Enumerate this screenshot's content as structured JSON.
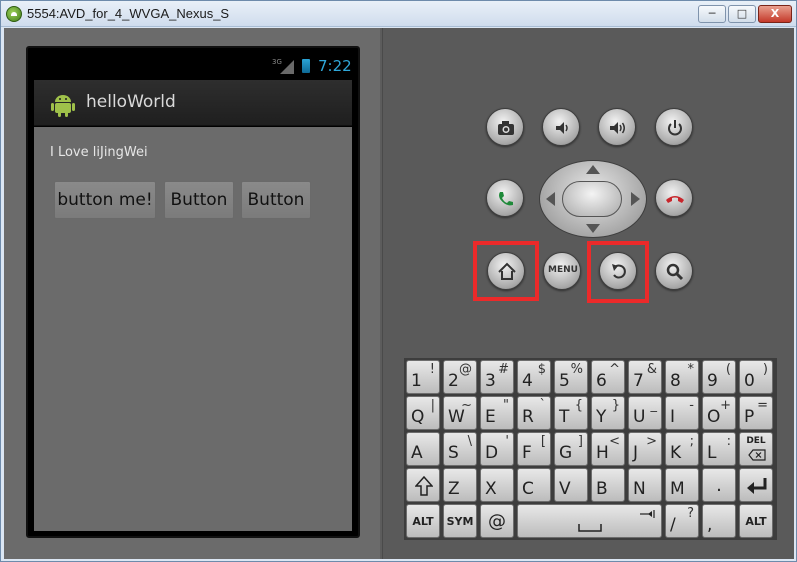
{
  "window": {
    "title": "5554:AVD_for_4_WVGA_Nexus_S",
    "minimize": "─",
    "maximize": "□",
    "close": "X"
  },
  "phone": {
    "network": "3G",
    "time": "7:22",
    "app_title": "helloWorld",
    "text": "I Love liJingWei",
    "buttons": [
      "button me!",
      "Button",
      "Button"
    ]
  },
  "controls": {
    "menu_label": "MENU"
  },
  "keyboard": {
    "row1": [
      {
        "main": "1",
        "alt": "!"
      },
      {
        "main": "2",
        "alt": "@"
      },
      {
        "main": "3",
        "alt": "#"
      },
      {
        "main": "4",
        "alt": "$"
      },
      {
        "main": "5",
        "alt": "%"
      },
      {
        "main": "6",
        "alt": "^"
      },
      {
        "main": "7",
        "alt": "&"
      },
      {
        "main": "8",
        "alt": "*"
      },
      {
        "main": "9",
        "alt": "("
      },
      {
        "main": "0",
        "alt": ")"
      }
    ],
    "row2": [
      {
        "main": "Q",
        "alt": "|"
      },
      {
        "main": "W",
        "alt": "~"
      },
      {
        "main": "E",
        "alt": "\""
      },
      {
        "main": "R",
        "alt": "`"
      },
      {
        "main": "T",
        "alt": "{"
      },
      {
        "main": "Y",
        "alt": "}"
      },
      {
        "main": "U",
        "alt": "_"
      },
      {
        "main": "I",
        "alt": "-"
      },
      {
        "main": "O",
        "alt": "+"
      },
      {
        "main": "P",
        "alt": "="
      }
    ],
    "row3": [
      {
        "main": "A",
        "alt": ""
      },
      {
        "main": "S",
        "alt": "\\"
      },
      {
        "main": "D",
        "alt": "'"
      },
      {
        "main": "F",
        "alt": "["
      },
      {
        "main": "G",
        "alt": "]"
      },
      {
        "main": "H",
        "alt": "<"
      },
      {
        "main": "J",
        "alt": ">"
      },
      {
        "main": "K",
        "alt": ";"
      },
      {
        "main": "L",
        "alt": ":"
      }
    ],
    "del_label": "DEL",
    "row4": [
      {
        "main": "Z",
        "alt": ""
      },
      {
        "main": "X",
        "alt": ""
      },
      {
        "main": "C",
        "alt": ""
      },
      {
        "main": "V",
        "alt": ""
      },
      {
        "main": "B",
        "alt": ""
      },
      {
        "main": "N",
        "alt": ""
      },
      {
        "main": "M",
        "alt": ""
      },
      {
        "main": ".",
        "alt": ""
      }
    ],
    "alt_label": "ALT",
    "sym_label": "SYM",
    "at_label": "@",
    "slash": {
      "main": "/",
      "alt": "?"
    },
    "comma": {
      "main": ",",
      "alt": ""
    }
  }
}
